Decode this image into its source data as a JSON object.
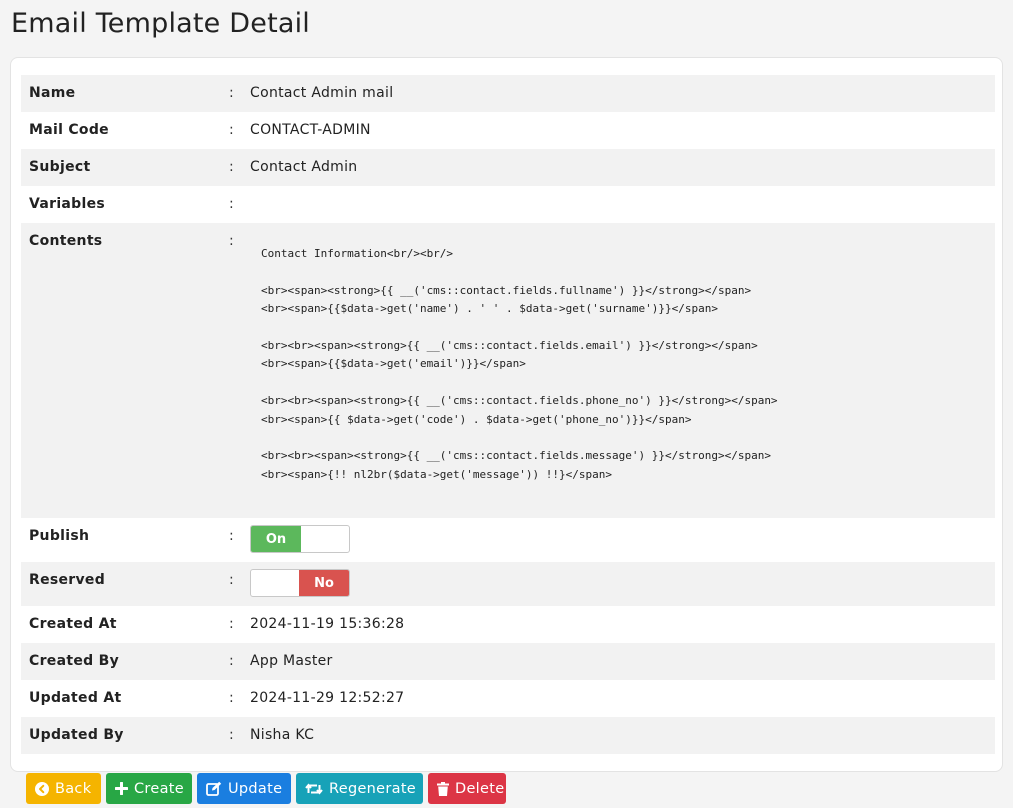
{
  "page": {
    "title": "Email Template Detail"
  },
  "fields": {
    "name": {
      "label": "Name",
      "value": "Contact Admin mail"
    },
    "mail_code": {
      "label": "Mail Code",
      "value": "CONTACT-ADMIN"
    },
    "subject": {
      "label": "Subject",
      "value": "Contact Admin"
    },
    "variables": {
      "label": "Variables",
      "value": ""
    },
    "contents": {
      "label": "Contents",
      "value": "Contact Information<br/><br/>\n\n<br><span><strong>{{ __('cms::contact.fields.fullname') }}</strong></span>\n<br><span>{{$data->get('name') . ' ' . $data->get('surname')}}</span>\n\n<br><br><span><strong>{{ __('cms::contact.fields.email') }}</strong></span>\n<br><span>{{$data->get('email')}}</span>\n\n<br><br><span><strong>{{ __('cms::contact.fields.phone_no') }}</strong></span>\n<br><span>{{ $data->get('code') . $data->get('phone_no')}}</span>\n\n<br><br><span><strong>{{ __('cms::contact.fields.message') }}</strong></span>\n<br><span>{!! nl2br($data->get('message')) !!}</span>"
    },
    "publish": {
      "label": "Publish",
      "state_label": "On"
    },
    "reserved": {
      "label": "Reserved",
      "state_label": "No"
    },
    "created_at": {
      "label": "Created At",
      "value": "2024-11-19 15:36:28"
    },
    "created_by": {
      "label": "Created By",
      "value": "App Master"
    },
    "updated_at": {
      "label": "Updated At",
      "value": "2024-11-29 12:52:27"
    },
    "updated_by": {
      "label": "Updated By",
      "value": "Nisha KC"
    }
  },
  "separator": ":",
  "toolbar": {
    "back": {
      "label": "Back",
      "icon": "arrow-left-circle-icon",
      "color": "#f5b400"
    },
    "create": {
      "label": "Create",
      "icon": "plus-icon",
      "color": "#28a745"
    },
    "update": {
      "label": "Update",
      "icon": "edit-icon",
      "color": "#1a7ee0"
    },
    "regenerate": {
      "label": "Regenerate",
      "icon": "retweet-icon",
      "color": "#17a2b8"
    },
    "delete": {
      "label": "Delete",
      "icon": "trash-icon",
      "color": "#dc3545"
    }
  },
  "colors": {
    "switch_on": "#5cb85c",
    "switch_no": "#d9534f"
  }
}
